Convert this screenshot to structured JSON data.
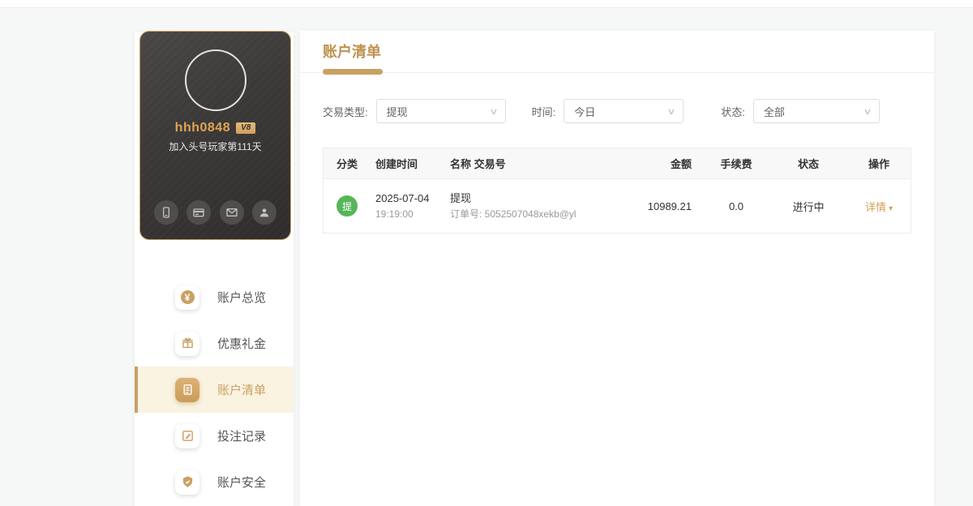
{
  "profile": {
    "username": "hhh0848",
    "vip_badge": "V8",
    "join_text": "加入头号玩家第111天",
    "quick_icons": [
      "phone-icon",
      "bank-card-icon",
      "mail-icon",
      "agent-icon"
    ]
  },
  "sidebar": {
    "items": [
      {
        "label": "账户总览",
        "icon": "coin-icon",
        "active": false
      },
      {
        "label": "优惠礼金",
        "icon": "gift-icon",
        "active": false
      },
      {
        "label": "账户清单",
        "icon": "statement-icon",
        "active": true
      },
      {
        "label": "投注记录",
        "icon": "bet-record-icon",
        "active": false
      },
      {
        "label": "账户安全",
        "icon": "shield-icon",
        "active": false
      }
    ]
  },
  "main": {
    "title": "账户清单",
    "filters": [
      {
        "label": "交易类型:",
        "value": "提现"
      },
      {
        "label": "时间:",
        "value": "今日"
      },
      {
        "label": "状态:",
        "value": "全部"
      }
    ],
    "table": {
      "headers": [
        "分类",
        "创建时间",
        "名称 交易号",
        "金额",
        "手续费",
        "状态",
        "操作"
      ],
      "rows": [
        {
          "category_badge": "提",
          "date": "2025-07-04",
          "time": "19:19:00",
          "name": "提现",
          "order_no": "订单号: 5052507048xekb@yl",
          "amount": "10989.21",
          "fee": "0.0",
          "status": "进行中",
          "action": "详情"
        }
      ]
    }
  },
  "colors": {
    "gold": "#c9a063",
    "gold_text": "#bf9150",
    "badge_green": "#57b55a",
    "active_item_bg": "#faf3e1",
    "card_border": "#c9a063",
    "page_bg": "#f6f7f7"
  }
}
